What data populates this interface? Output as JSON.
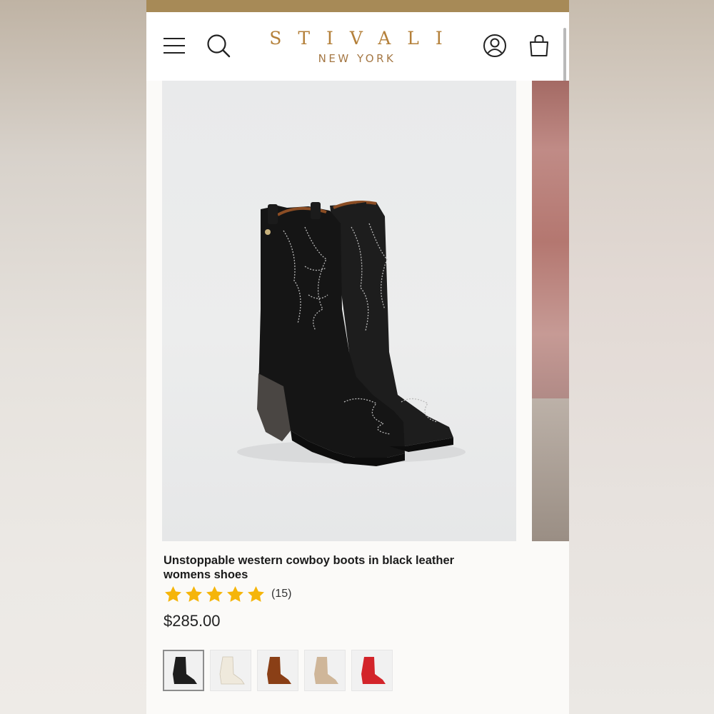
{
  "brand": {
    "name": "STIVALI",
    "subtitle": "NEW YORK"
  },
  "header": {
    "menu_icon": "hamburger-menu-icon",
    "search_icon": "search-icon",
    "account_icon": "account-icon",
    "cart_icon": "shopping-bag-icon"
  },
  "product": {
    "title": "Unstoppable western cowboy boots in black leather womens shoes",
    "rating": 5,
    "review_count": "(15)",
    "price": "$285.00"
  },
  "swatches": [
    {
      "color": "black",
      "hex": "#1e1e1e",
      "selected": true
    },
    {
      "color": "white",
      "hex": "#efe9dc",
      "selected": false
    },
    {
      "color": "brown suede",
      "hex": "#8a3f16",
      "selected": false
    },
    {
      "color": "beige",
      "hex": "#cfb699",
      "selected": false
    },
    {
      "color": "red",
      "hex": "#d3242a",
      "selected": false
    }
  ],
  "colors": {
    "topbar": "#a78a57",
    "logo": "#b4803a",
    "star": "#f5b50a"
  }
}
